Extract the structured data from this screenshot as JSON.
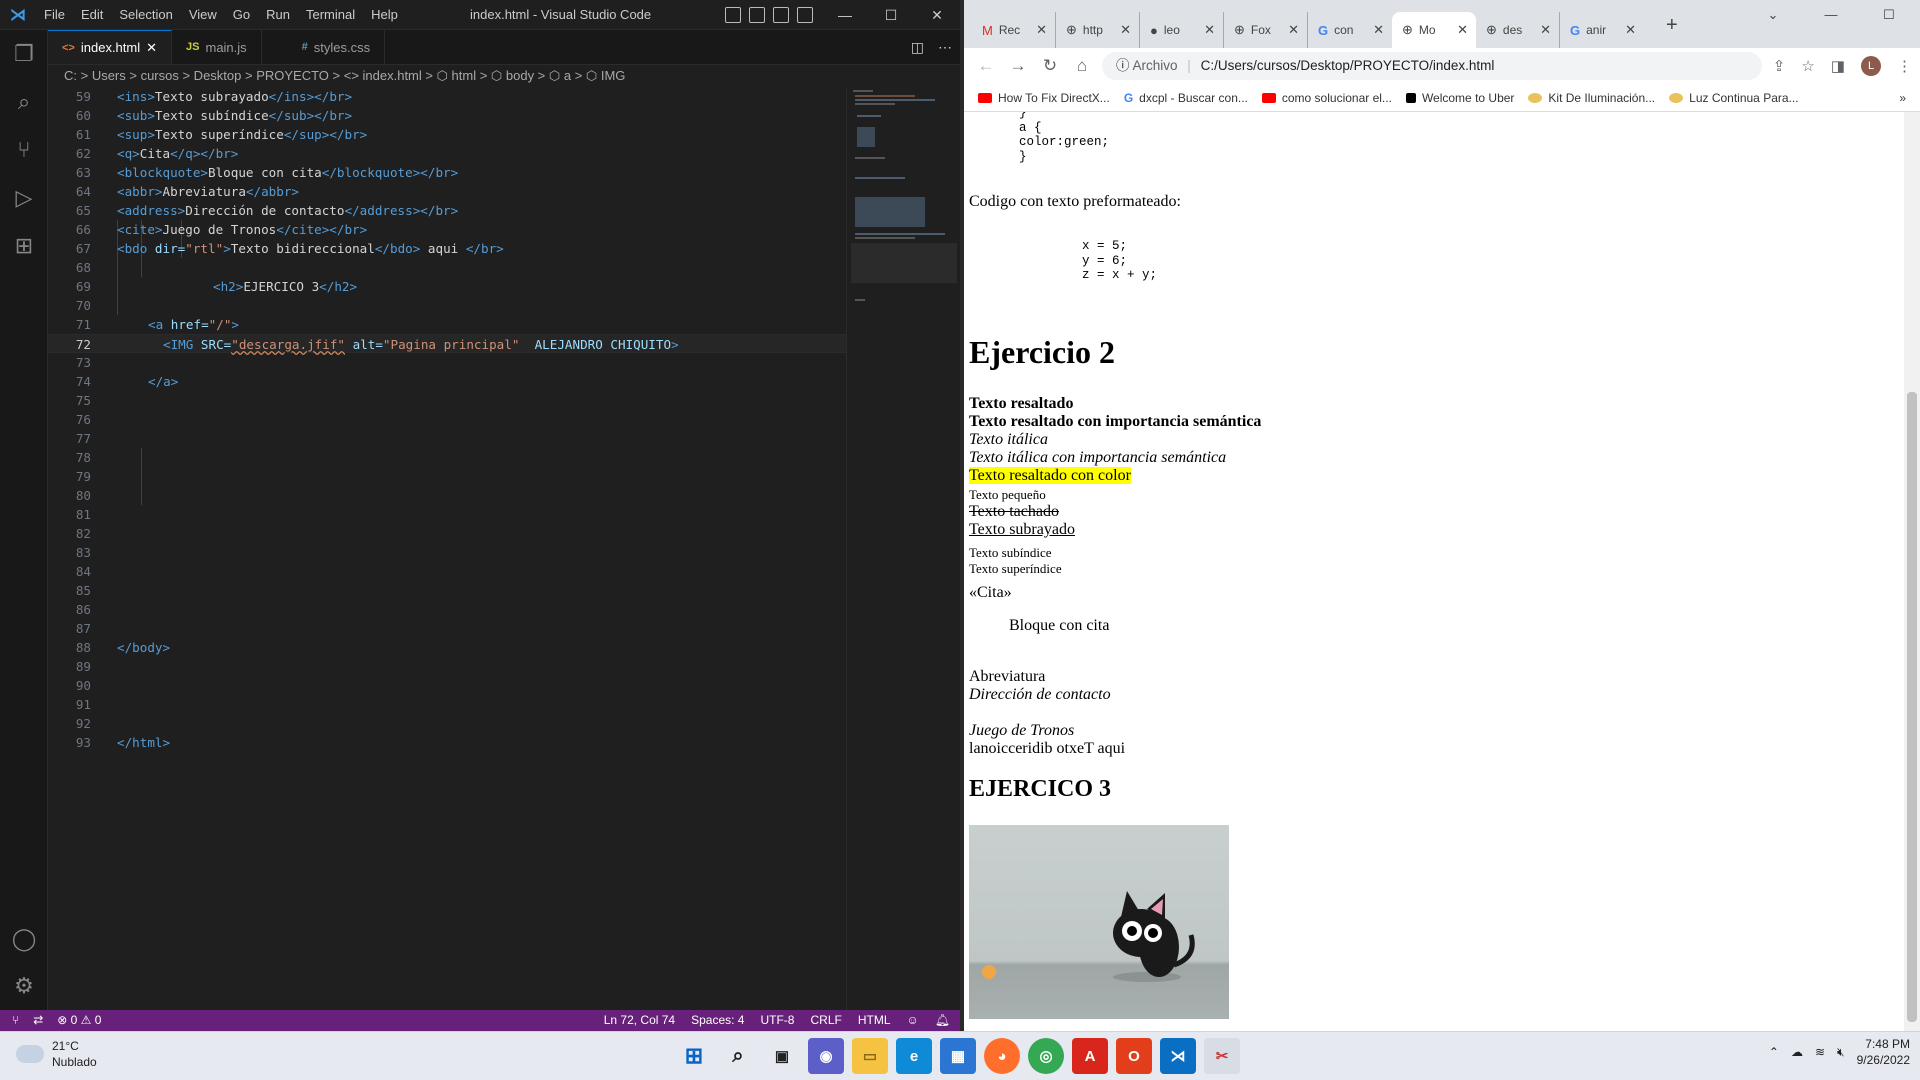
{
  "vscode": {
    "menu": [
      "File",
      "Edit",
      "Selection",
      "View",
      "Go",
      "Run",
      "Terminal",
      "Help"
    ],
    "title": "index.html - Visual Studio Code",
    "tabs": [
      {
        "label": "index.html",
        "icon": "<>"
      },
      {
        "label": "main.js",
        "icon": "JS"
      },
      {
        "label": "styles.css",
        "icon": "#"
      }
    ],
    "breadcrumb": "C: > Users > cursos > Desktop > PROYECTO > <> index.html > ⬡ html > ⬡ body > ⬡ a > ⬡ IMG",
    "line_numbers": [
      "59",
      "60",
      "61",
      "62",
      "63",
      "64",
      "65",
      "66",
      "67",
      "68",
      "69",
      "70",
      "71",
      "72",
      "73",
      "74",
      "75",
      "76",
      "77",
      "78",
      "79",
      "80",
      "81",
      "82",
      "83",
      "84",
      "85",
      "86",
      "87",
      "88",
      "89",
      "90",
      "91",
      "92",
      "93"
    ],
    "code": {
      "l59": [
        "<ins>",
        "Texto subrayado",
        "</ins></br>"
      ],
      "l60": [
        "<sub>",
        "Texto subíndice",
        "</sub></br>"
      ],
      "l61": [
        "<sup>",
        "Texto superíndice",
        "</sup></br>"
      ],
      "l62": [
        "<q>",
        "Cita",
        "</q></br>"
      ],
      "l63": [
        "<blockquote>",
        "Bloque con cita",
        "</blockquote></br>"
      ],
      "l64": [
        "<abbr>",
        "Abreviatura",
        "</abbr>"
      ],
      "l65": [
        "<address>",
        "Dirección de contacto",
        "</address></br>"
      ],
      "l66": [
        "<cite>",
        "Juego de Tronos",
        "</cite></br>"
      ],
      "l67": {
        "open": "<bdo ",
        "attr": "dir=",
        "val": "\"rtl\"",
        ">": ">",
        "text": "Texto bidireccional",
        "close": "</bdo>",
        "tail": " aqui ",
        "br": "</br>"
      },
      "l69": [
        "<h2>",
        "EJERCICO 3",
        "</h2>"
      ],
      "l71": {
        "open": "<a ",
        "attr": "href=",
        "val": "\"/\"",
        "gt": ">"
      },
      "l72": {
        "open": "<IMG ",
        "a1": "SRC=",
        "v1": "\"descarga.jfif\"",
        "a2": " alt=",
        "v2": "\"Pagina principal\"",
        "rest": "  ALEJANDRO CHIQUITO",
        "gt": ">"
      },
      "l74": "</a>",
      "l88": "</body>",
      "l93": "</html>"
    },
    "status": {
      "errors": "0",
      "warnings": "0",
      "position": "Ln 72, Col 74",
      "spaces": "Spaces: 4",
      "encoding": "UTF-8",
      "eol": "CRLF",
      "language": "HTML"
    }
  },
  "chrome": {
    "tabs": [
      "Rec",
      "http",
      "leo",
      "Fox",
      "con",
      "Mo",
      "des",
      "anir"
    ],
    "tab_icons": [
      "gmail-icon",
      "globe-icon",
      "github-icon",
      "globe-icon",
      "google-icon",
      "globe-icon",
      "globe-icon",
      "google-icon"
    ],
    "address_label": "Archivo",
    "url": "C:/Users/cursos/Desktop/PROYECTO/index.html",
    "avatar": "L",
    "bookmarks": [
      "How To Fix DirectX...",
      "dxcpl - Buscar con...",
      "como solucionar el...",
      "Welcome to Uber",
      "Kit De Iluminación...",
      "Luz Continua Para..."
    ],
    "page": {
      "css_pre": "    }\n    a {\n    color:green;\n    }",
      "pre_label": "Codigo con texto preformateado:",
      "pre_code": "x = 5;\ny = 6;\nz = x + y;",
      "h_ej2": "Ejercicio 2",
      "t_bold": "Texto resaltado",
      "t_strong": "Texto resaltado con importancia semántica",
      "t_i": "Texto itálica",
      "t_em": "Texto itálica con importancia semántica",
      "t_mark": "Texto resaltado con color",
      "t_small": "Texto pequeño",
      "t_del": "Texto tachado",
      "t_ins": "Texto subrayado",
      "t_sub": "Texto subíndice",
      "t_sup": "Texto superíndice",
      "t_q": "«Cita»",
      "t_blockquote": "Bloque con cita",
      "t_abbr": "Abreviatura",
      "t_address": "Dirección de contacto",
      "t_cite": "Juego de Tronos",
      "t_bdo": "lanoicceridib otxeT aqui",
      "h_ej3": "EJERCICO 3"
    }
  },
  "taskbar": {
    "temp": "21°C",
    "weather": "Nublado",
    "time": "7:48 PM",
    "date": "9/26/2022"
  }
}
